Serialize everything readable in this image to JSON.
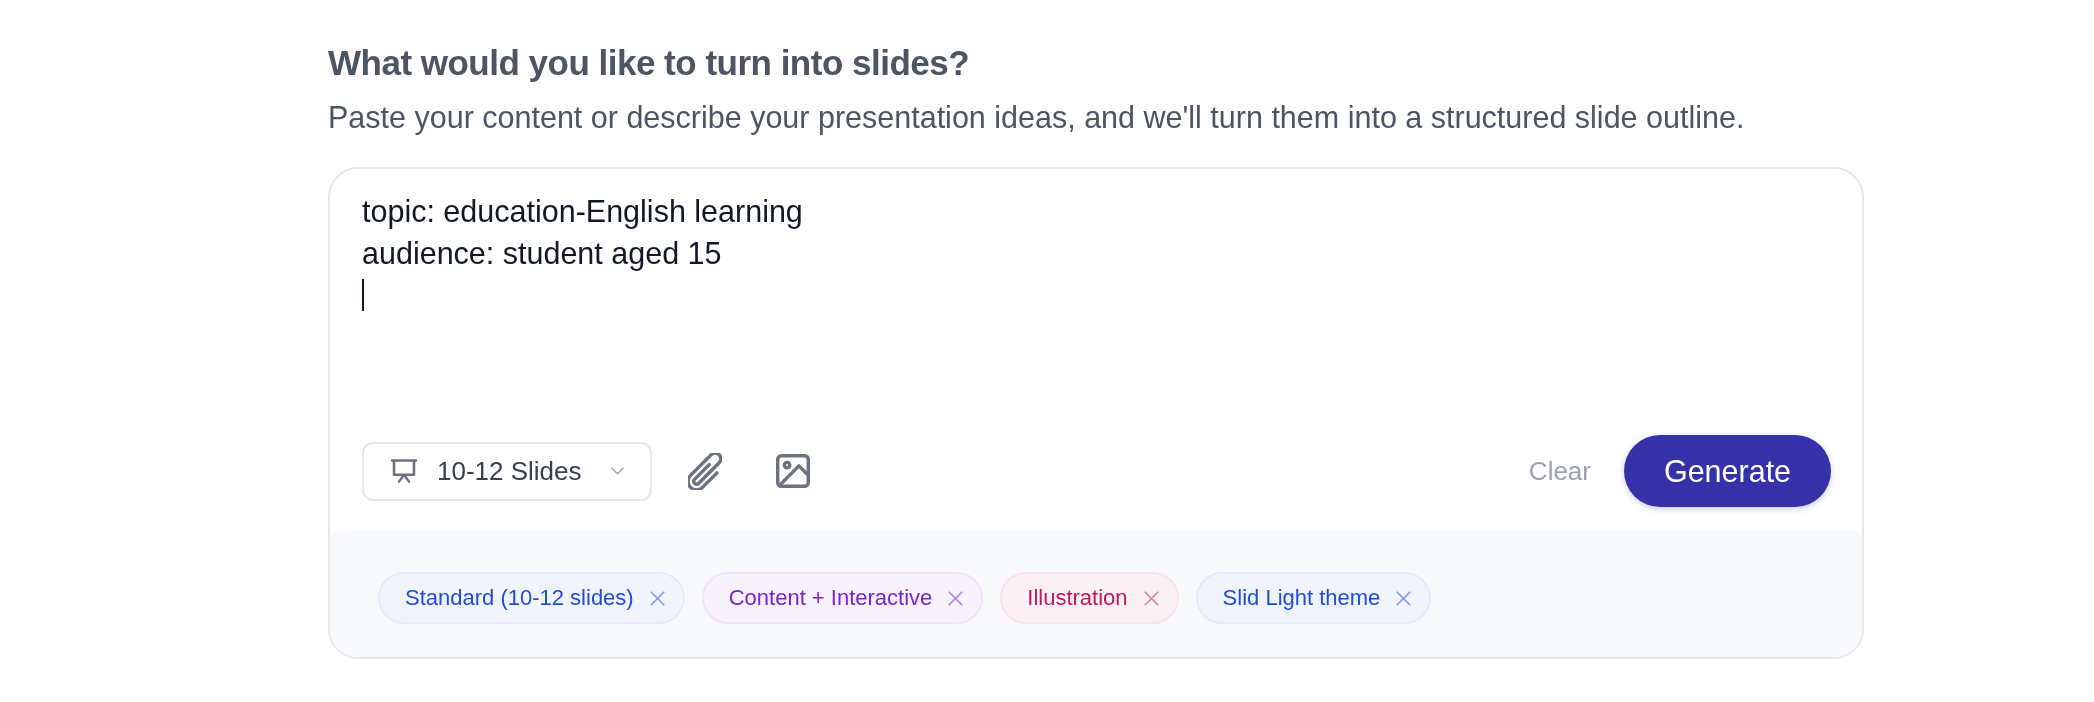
{
  "heading": {
    "title": "What would you like to turn into slides?",
    "subtitle": "Paste your content or describe your presentation ideas, and we'll turn them into a structured slide outline."
  },
  "input": {
    "value": "topic: education-English learning\naudience: student aged 15",
    "focused": true
  },
  "toolbar": {
    "slide_count": "10-12 Slides",
    "clear_button": "Clear",
    "generate_button": "Generate"
  },
  "tags": [
    {
      "label": "Standard (10-12 slides)",
      "color": "#1d4ed8"
    },
    {
      "label": "Content + Interactive",
      "color": "#7e22ce"
    },
    {
      "label": "Illustration",
      "color": "#be185d"
    },
    {
      "label": "Slid Light theme",
      "color": "#1d4ed8"
    }
  ]
}
